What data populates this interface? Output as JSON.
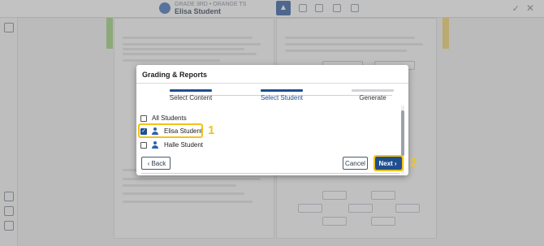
{
  "student_header": {
    "subtitle": "GRADE 3RD • ORANGE TS",
    "name": "Elisa Student"
  },
  "modal": {
    "title": "Grading & Reports",
    "steps": [
      {
        "label": "Select Content",
        "state": "done"
      },
      {
        "label": "Select Student",
        "state": "active"
      },
      {
        "label": "Generate",
        "state": "pending"
      }
    ],
    "students": [
      {
        "label": "All Students",
        "checked": false,
        "has_icon": false
      },
      {
        "label": "Elisa Student",
        "checked": true,
        "has_icon": true
      },
      {
        "label": "Halle Student",
        "checked": false,
        "has_icon": true
      }
    ],
    "buttons": {
      "back": "Back",
      "cancel": "Cancel",
      "next": "Next"
    }
  },
  "callouts": {
    "one": "1",
    "two": "2"
  },
  "colors": {
    "primary": "#1e4f8f",
    "highlight": "#f2c21b"
  },
  "icons": {
    "avatar": "person-icon",
    "back": "chevron-left-icon",
    "next": "chevron-right-icon",
    "check": "checkmark-icon"
  }
}
